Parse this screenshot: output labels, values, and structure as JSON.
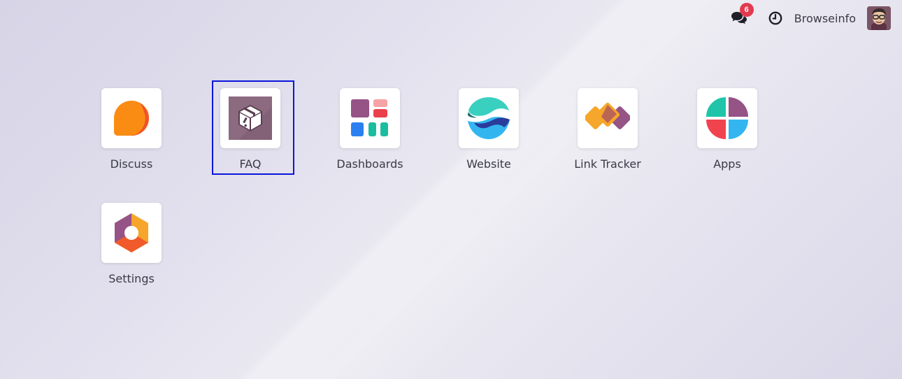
{
  "topbar": {
    "chat_badge_count": "6",
    "username": "Browseinfo"
  },
  "apps": [
    {
      "label": "Discuss"
    },
    {
      "label": "FAQ"
    },
    {
      "label": "Dashboards"
    },
    {
      "label": "Website"
    },
    {
      "label": "Link Tracker"
    },
    {
      "label": "Apps"
    },
    {
      "label": "Settings"
    }
  ],
  "colors": {
    "badge": "#e23a4e",
    "selection_outline": "#0a16d8",
    "faq_icon_bg": "#8c6a80"
  },
  "icons": {
    "chat": "chat-bubbles-icon",
    "clock": "clock-icon"
  }
}
